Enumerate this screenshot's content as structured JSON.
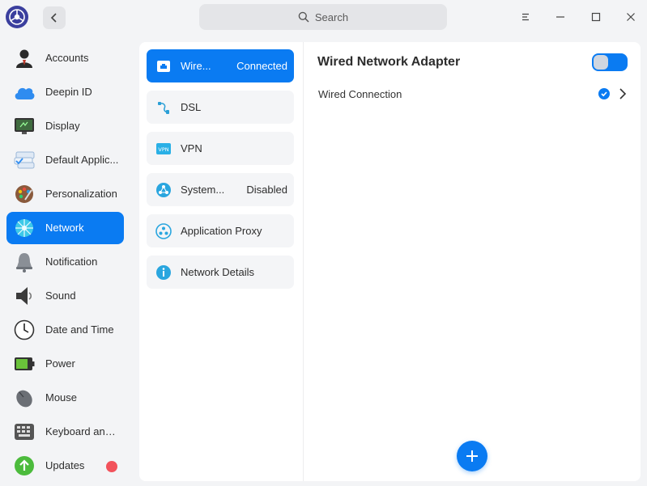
{
  "titlebar": {
    "search_placeholder": "Search"
  },
  "sidebar": {
    "items": [
      {
        "label": "Accounts",
        "icon": "user-account-icon"
      },
      {
        "label": "Deepin ID",
        "icon": "cloud-icon"
      },
      {
        "label": "Display",
        "icon": "monitor-icon"
      },
      {
        "label": "Default Applic...",
        "icon": "default-apps-icon"
      },
      {
        "label": "Personalization",
        "icon": "palette-icon"
      },
      {
        "label": "Network",
        "icon": "network-globe-icon",
        "active": true
      },
      {
        "label": "Notification",
        "icon": "bell-icon"
      },
      {
        "label": "Sound",
        "icon": "speaker-icon"
      },
      {
        "label": "Date and Time",
        "icon": "clock-icon"
      },
      {
        "label": "Power",
        "icon": "battery-icon"
      },
      {
        "label": "Mouse",
        "icon": "mouse-icon"
      },
      {
        "label": "Keyboard and ...",
        "icon": "keyboard-icon"
      },
      {
        "label": "Updates",
        "icon": "update-arrow-icon",
        "badge": true
      }
    ]
  },
  "network_menu": {
    "items": [
      {
        "label": "Wire...",
        "status": "Connected",
        "icon": "wired-network-icon",
        "active": true
      },
      {
        "label": "DSL",
        "status": "",
        "icon": "dsl-icon"
      },
      {
        "label": "VPN",
        "status": "",
        "icon": "vpn-icon"
      },
      {
        "label": "System...",
        "status": "Disabled",
        "icon": "system-proxy-icon"
      },
      {
        "label": "Application Proxy",
        "status": "",
        "icon": "application-proxy-icon"
      },
      {
        "label": "Network Details",
        "status": "",
        "icon": "info-icon"
      }
    ]
  },
  "detail": {
    "title": "Wired Network Adapter",
    "toggle_on": true,
    "connection_label": "Wired Connection",
    "connection_active": true
  },
  "colors": {
    "accent": "#0a7bf2",
    "badge": "#f2525b",
    "background": "#f3f4f6",
    "panel": "#ffffff"
  }
}
